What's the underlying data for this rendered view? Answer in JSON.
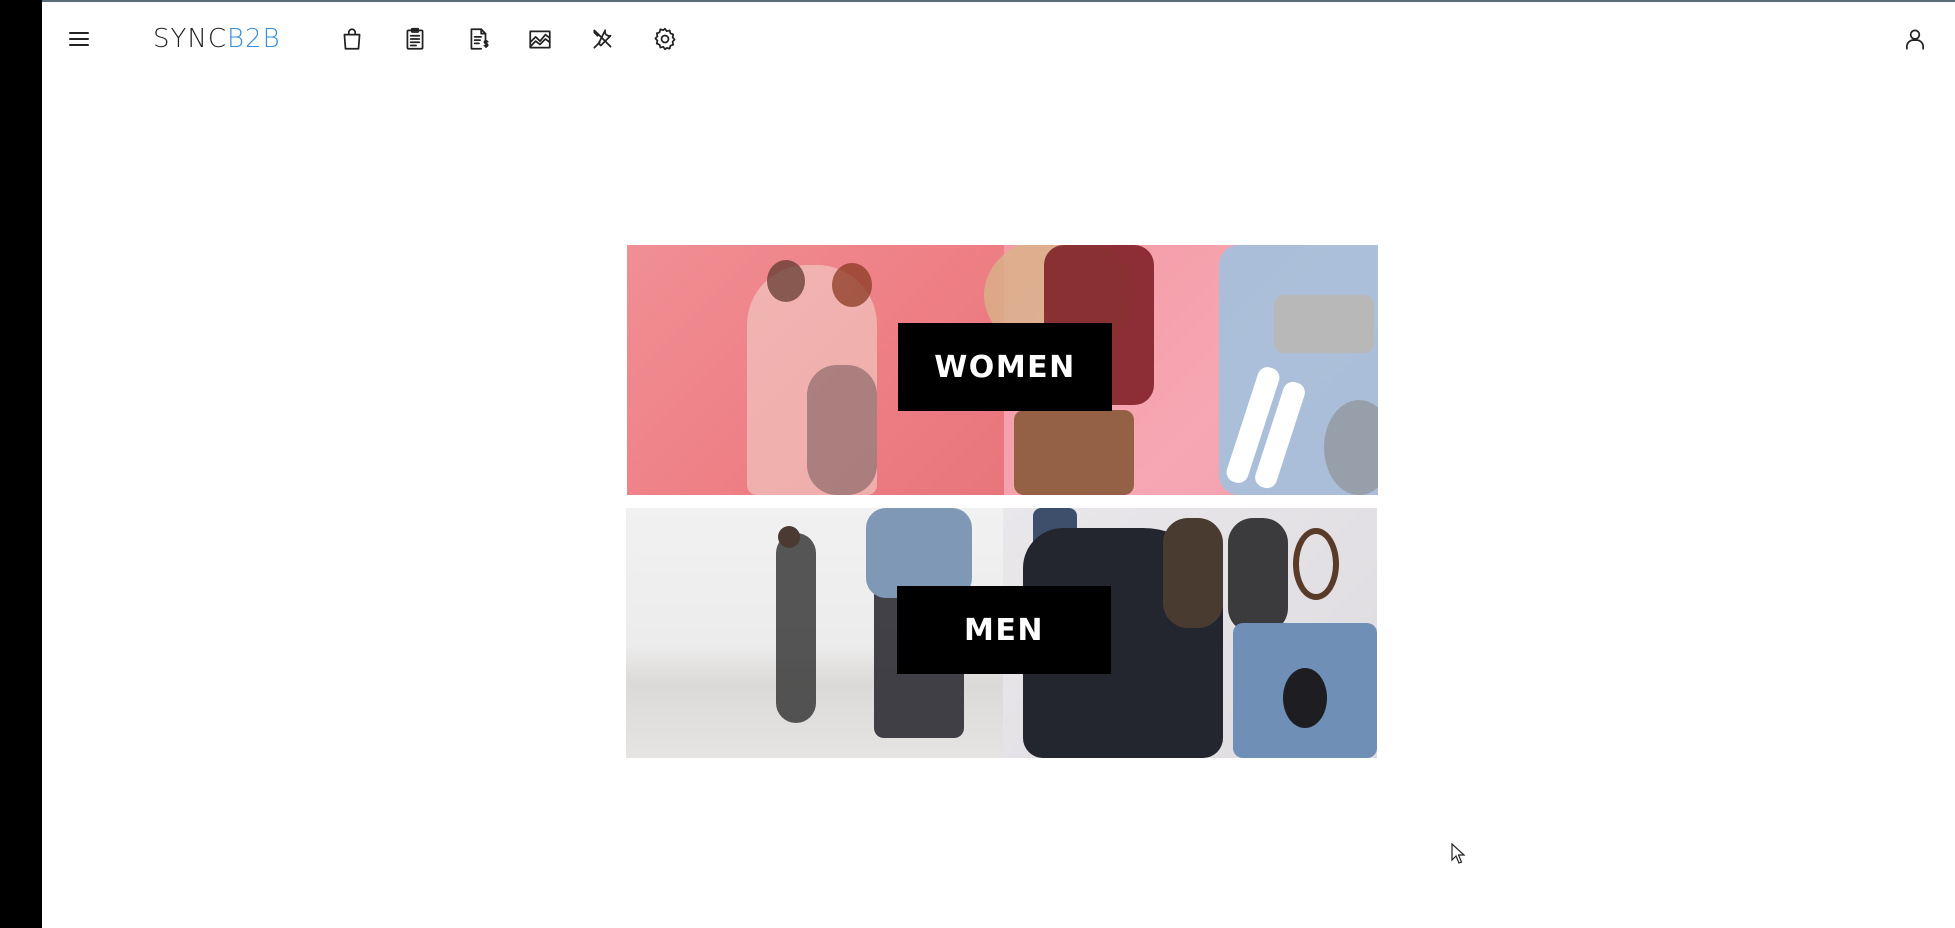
{
  "app": {
    "brand_prefix": "SYNC",
    "brand_suffix": "B2B"
  },
  "toolbar": {
    "icons": [
      "menu-icon",
      "shopping-bag-icon",
      "clipboard-icon",
      "invoice-icon",
      "chart-icon",
      "tools-icon",
      "gear-icon",
      "user-icon"
    ]
  },
  "categories": [
    {
      "label": "WOMEN"
    },
    {
      "label": "MEN"
    }
  ],
  "colors": {
    "brand_accent": "#3a8fd6",
    "text": "#222222",
    "label_bg": "#000000",
    "label_text": "#ffffff",
    "women_pink": "#ee7f85",
    "men_gray": "#ececec"
  }
}
